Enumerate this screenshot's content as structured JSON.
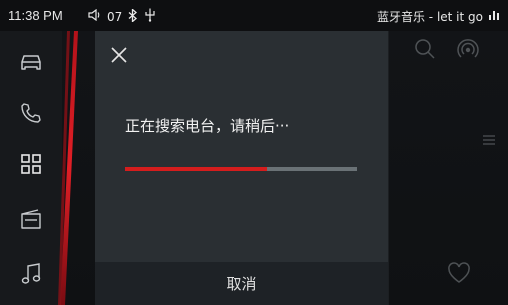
{
  "status_bar": {
    "time": "11:38 PM",
    "volume": "07",
    "now_playing": "蓝牙音乐 - let it go",
    "icons": [
      "volume-icon",
      "bluetooth-icon",
      "usb-icon",
      "equalizer-icon"
    ]
  },
  "sidebar": {
    "items": [
      {
        "icon": "car-icon"
      },
      {
        "icon": "phone-icon"
      },
      {
        "icon": "apps-grid-icon"
      },
      {
        "icon": "radio-icon"
      },
      {
        "icon": "music-note-icon"
      }
    ]
  },
  "background": {
    "icons": [
      "search-icon",
      "broadcast-icon",
      "menu-icon",
      "heart-icon"
    ]
  },
  "dialog": {
    "message": "正在搜索电台，请稍后···",
    "progress": 0.61,
    "cancel_label": "取消"
  },
  "colors": {
    "accent": "#d41d1d",
    "dialog_bg": "#2a2f33",
    "footer_bg": "#1e2226",
    "track": "#6a7276"
  }
}
